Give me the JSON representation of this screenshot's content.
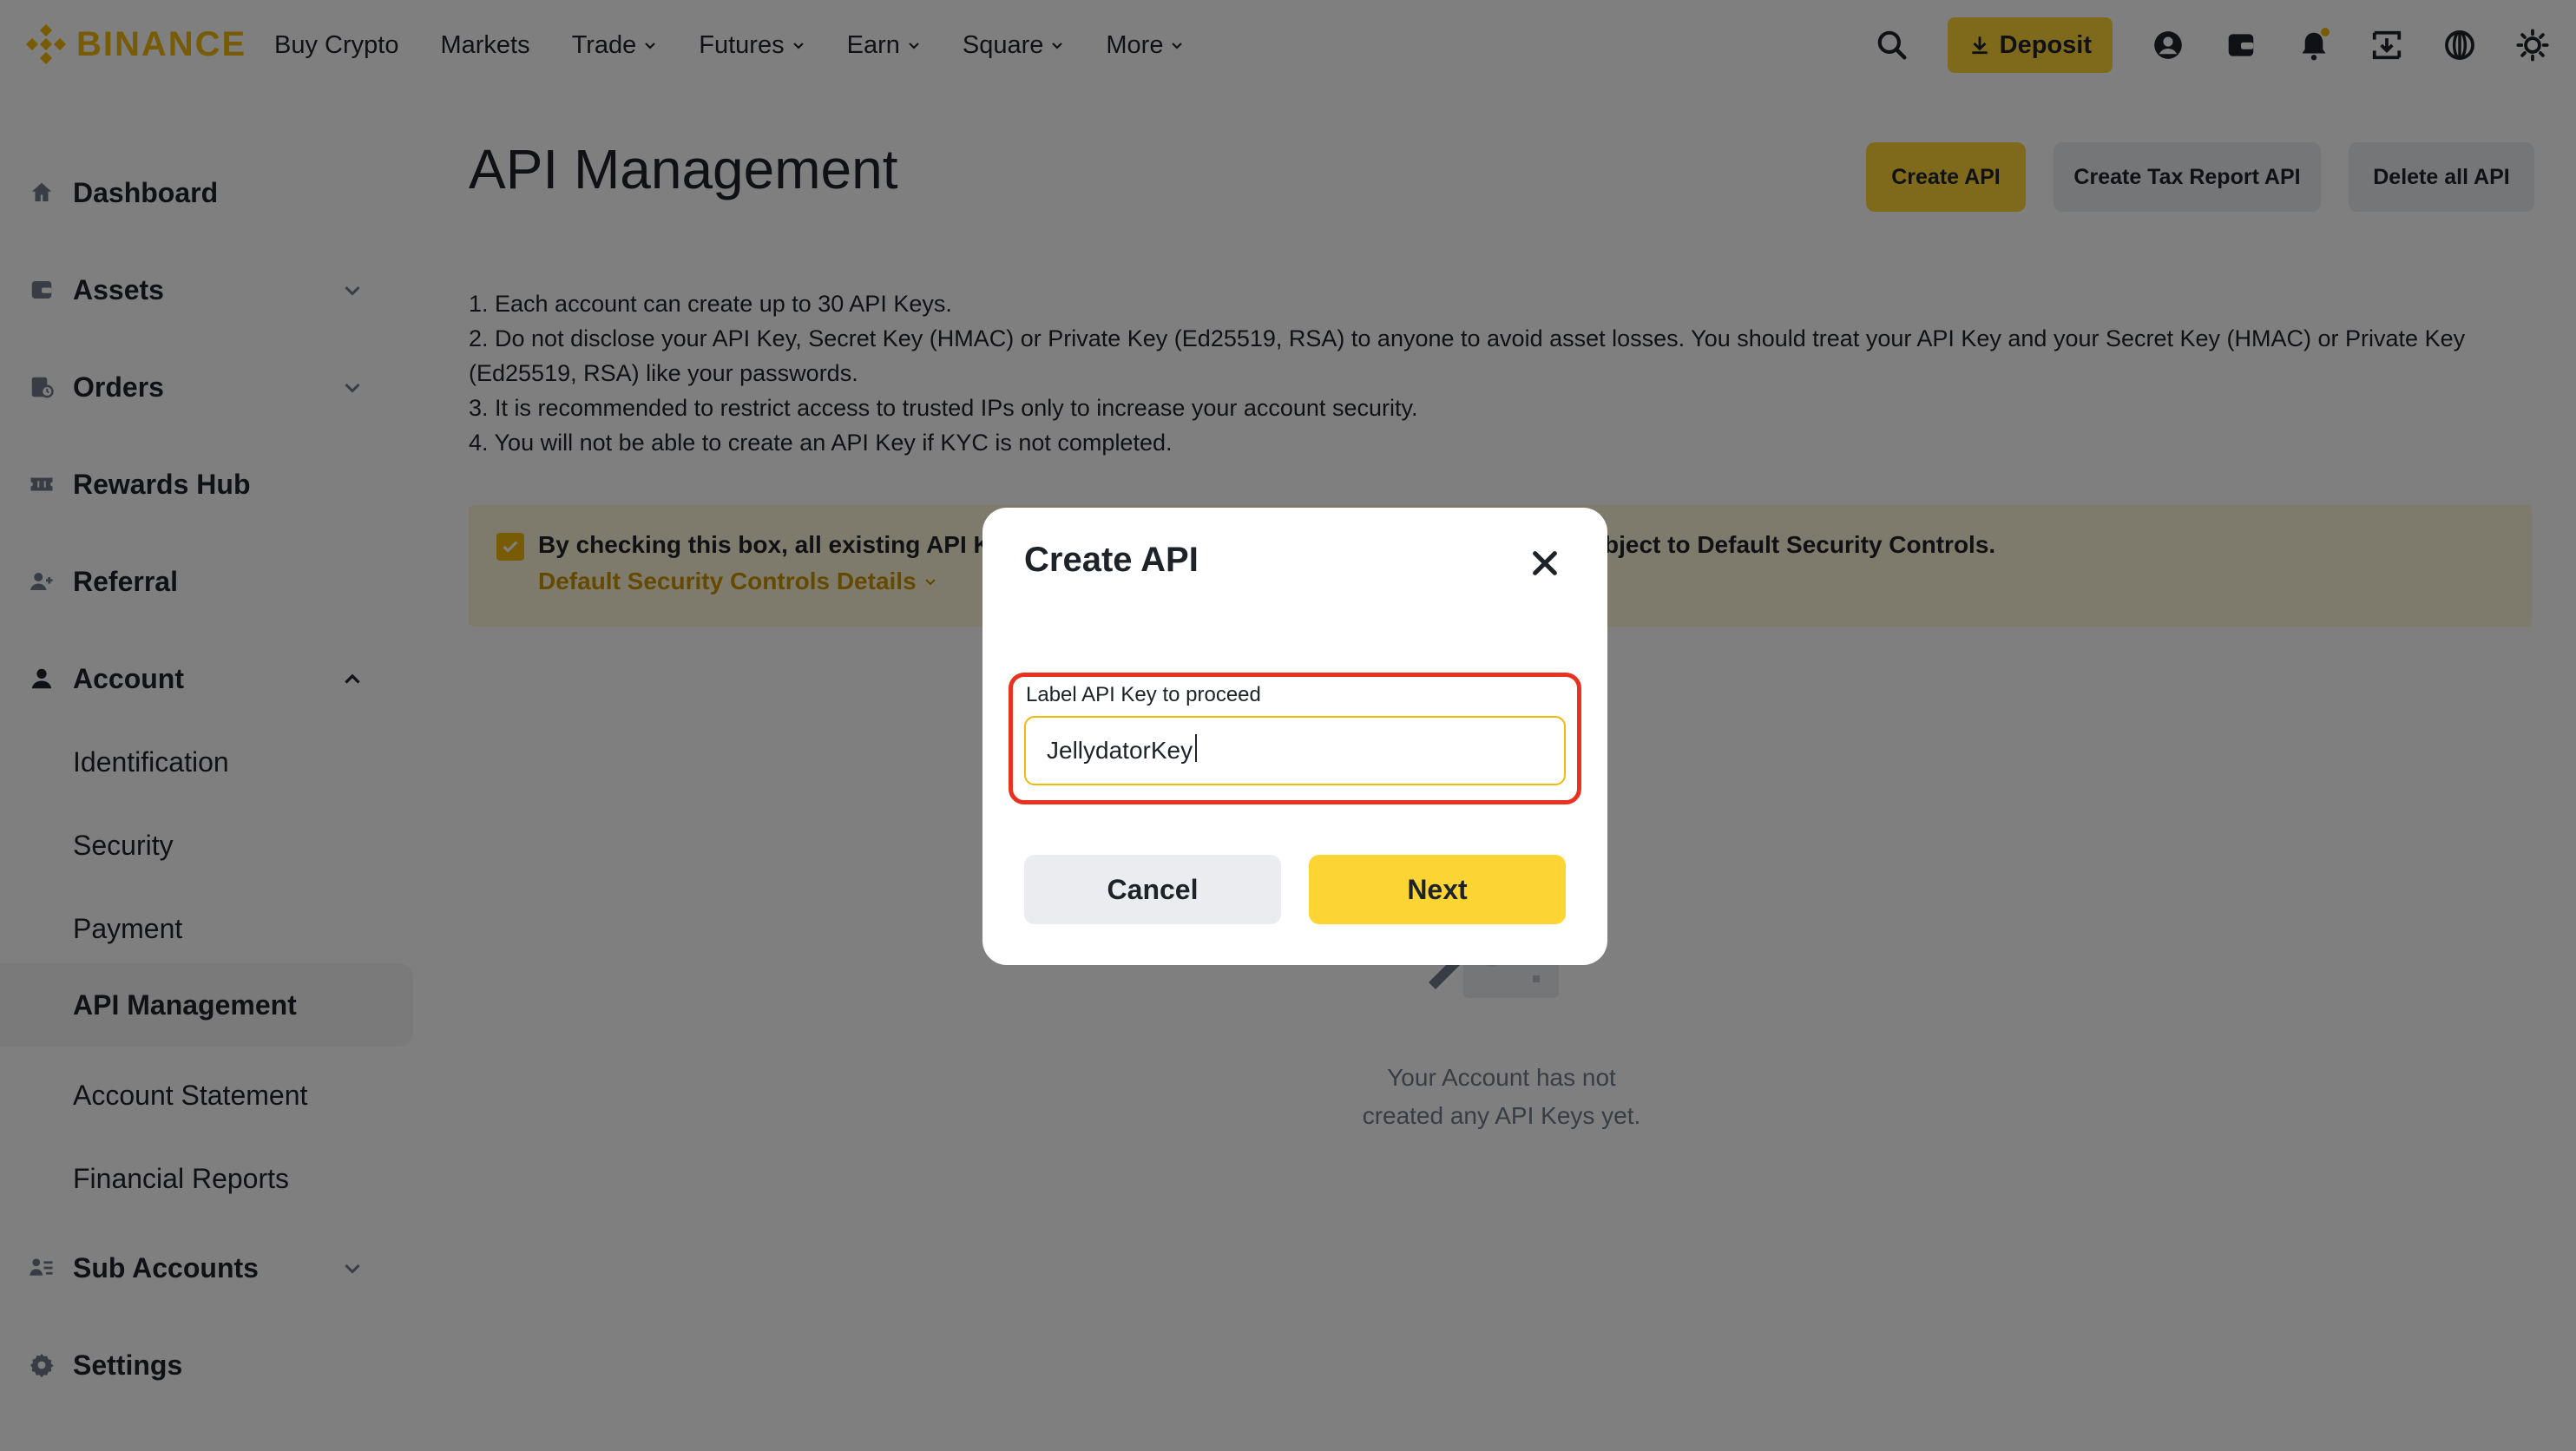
{
  "brand": {
    "name": "BINANCE",
    "color": "#f0b90b"
  },
  "nav": {
    "items": [
      {
        "label": "Buy Crypto",
        "dropdown": false
      },
      {
        "label": "Markets",
        "dropdown": false
      },
      {
        "label": "Trade",
        "dropdown": true
      },
      {
        "label": "Futures",
        "dropdown": true
      },
      {
        "label": "Earn",
        "dropdown": true
      },
      {
        "label": "Square",
        "dropdown": true
      },
      {
        "label": "More",
        "dropdown": true
      }
    ],
    "deposit_label": "Deposit",
    "icons": [
      "search-icon",
      "account-icon",
      "wallet-icon",
      "notification-bell-icon",
      "download-app-icon",
      "language-globe-icon",
      "theme-toggle-icon"
    ]
  },
  "sidebar": {
    "items": [
      {
        "label": "Dashboard",
        "icon": "home-icon"
      },
      {
        "label": "Assets",
        "icon": "wallet-icon",
        "expand": "down"
      },
      {
        "label": "Orders",
        "icon": "orders-icon",
        "expand": "down"
      },
      {
        "label": "Rewards Hub",
        "icon": "ticket-icon"
      },
      {
        "label": "Referral",
        "icon": "add-person-icon"
      },
      {
        "label": "Account",
        "icon": "person-icon",
        "expand": "up"
      },
      {
        "label": "Identification"
      },
      {
        "label": "Security"
      },
      {
        "label": "Payment"
      },
      {
        "label": "API Management",
        "active": true
      },
      {
        "label": "Account Statement"
      },
      {
        "label": "Financial Reports"
      },
      {
        "label": "Sub Accounts",
        "icon": "sub-accounts-icon",
        "expand": "down"
      },
      {
        "label": "Settings",
        "icon": "gear-icon"
      }
    ]
  },
  "main": {
    "title": "API Management",
    "buttons": {
      "create": "Create API",
      "tax": "Create Tax Report API",
      "delete_all": "Delete all API"
    },
    "notes": [
      "1. Each account can create up to 30 API Keys.",
      "2. Do not disclose your API Key, Secret Key (HMAC) or Private Key (Ed25519, RSA) to anyone to avoid asset losses. You should treat your API Key and your Secret Key (HMAC) or Private Key (Ed25519, RSA) like your passwords.",
      "3. It is recommended to restrict access to trusted IPs only to increase your account security.",
      "4. You will not be able to create an API Key if KYC is not completed."
    ],
    "consent": {
      "checked": true,
      "text_left": "By checking this box, all existing API Key",
      "text_right": "bject to Default Security Controls.",
      "link": "Default Security Controls Details"
    },
    "empty_state": {
      "line1": "Your Account has not",
      "line2": "created any API Keys yet."
    }
  },
  "modal": {
    "title": "Create API",
    "field_label": "Label API Key to proceed",
    "field_value": "JellydatorKey",
    "cancel_label": "Cancel",
    "next_label": "Next",
    "highlight_color": "#e8321f"
  }
}
